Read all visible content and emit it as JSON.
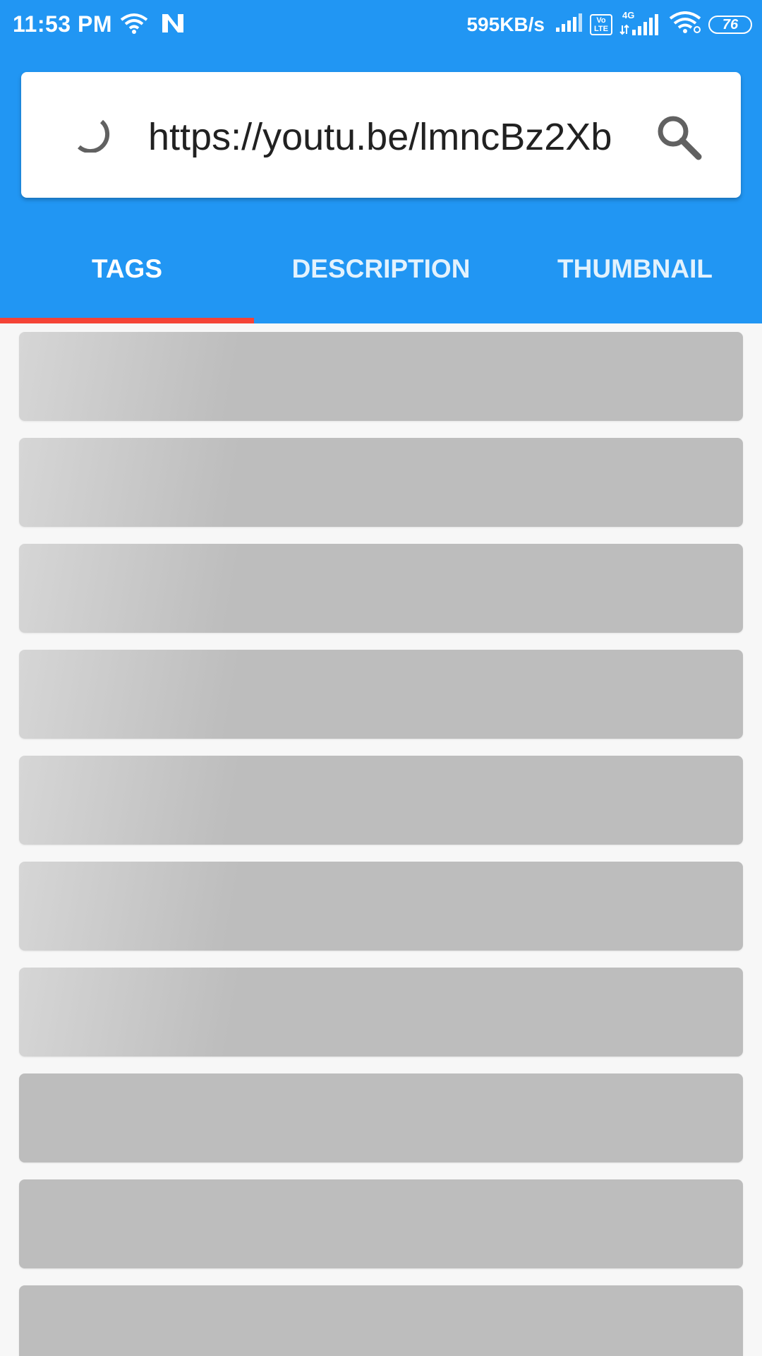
{
  "status_bar": {
    "time": "11:53 PM",
    "network_speed": "595KB/s",
    "volte_label": "Vo LTE",
    "network_type": "4G",
    "battery_level": "76"
  },
  "search": {
    "value": "https://youtu.be/lmncBz2Xb",
    "placeholder": ""
  },
  "tabs": [
    {
      "label": "TAGS",
      "selected": true
    },
    {
      "label": "DESCRIPTION",
      "selected": false
    },
    {
      "label": "THUMBNAIL",
      "selected": false
    }
  ],
  "colors": {
    "header": "#2196f3",
    "tab_indicator": "#f44336",
    "skeleton": "#bdbdbd"
  },
  "skeleton_rows": 10
}
